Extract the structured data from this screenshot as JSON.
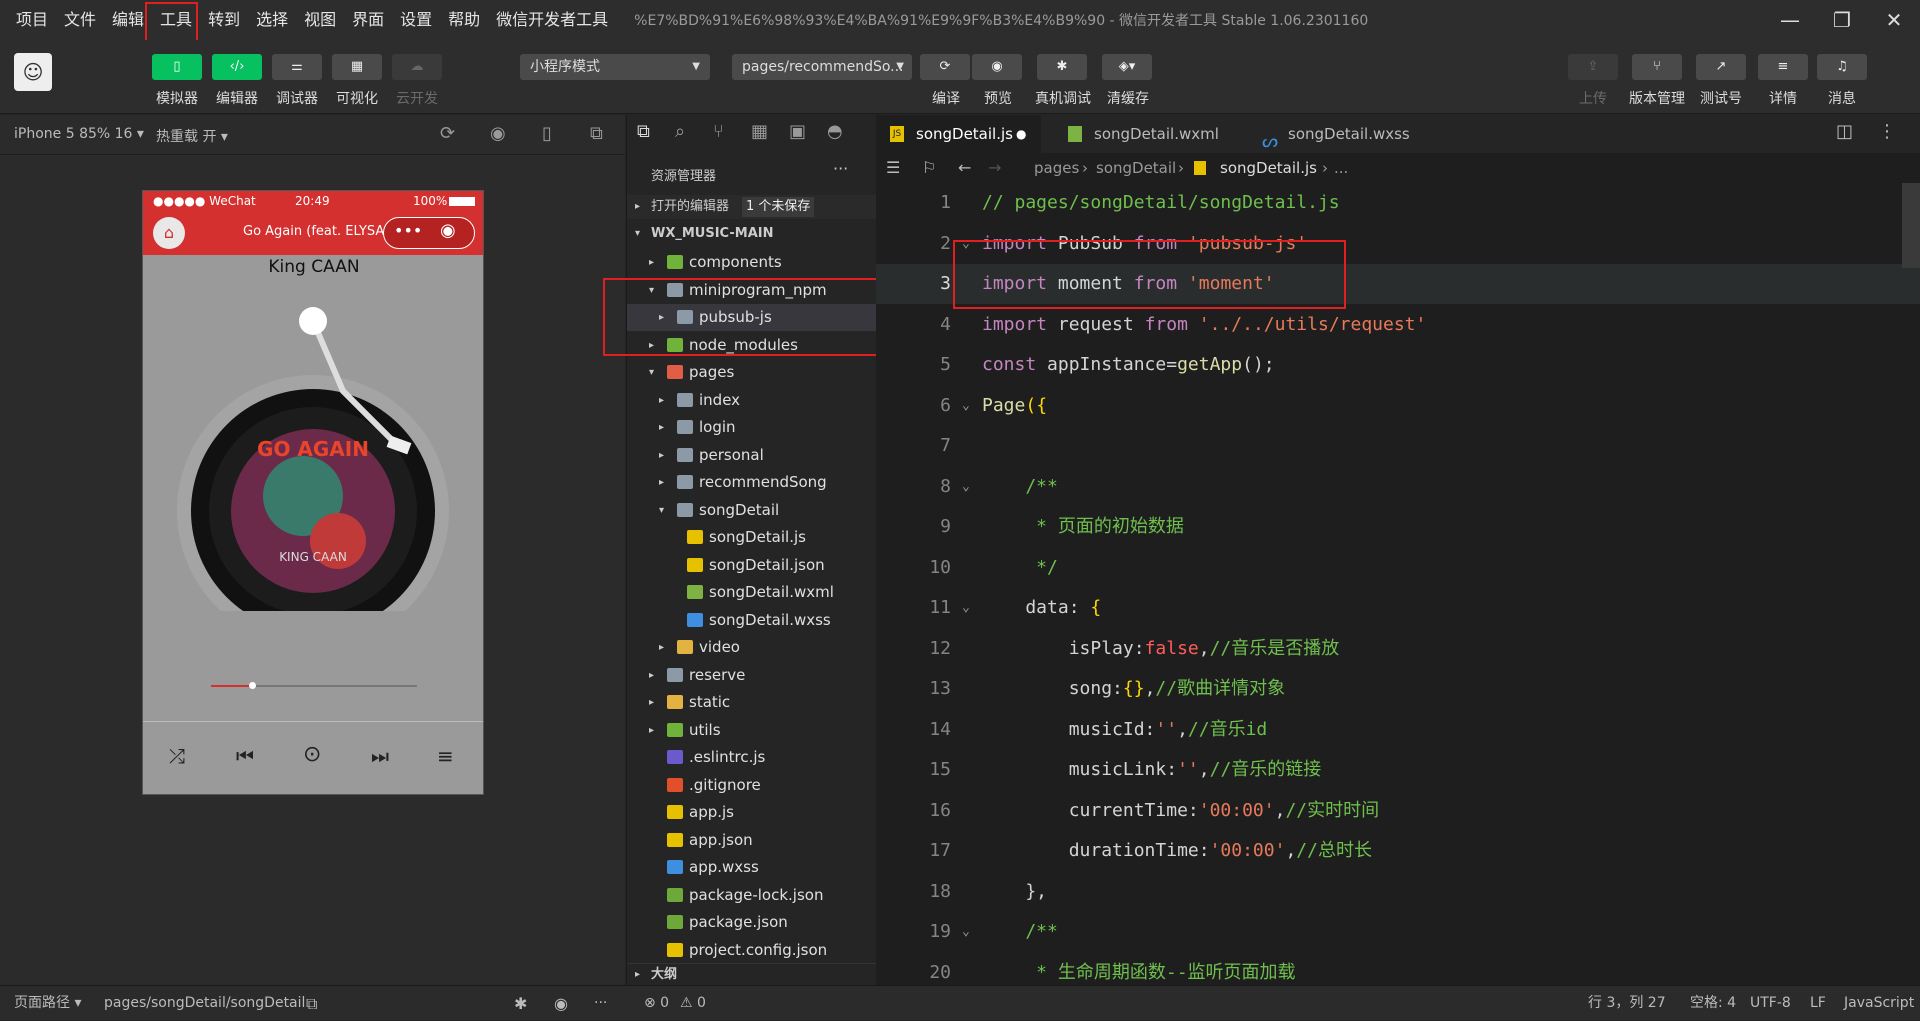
{
  "menubar": {
    "items": [
      "项目",
      "文件",
      "编辑",
      "工具",
      "转到",
      "选择",
      "视图",
      "界面",
      "设置",
      "帮助",
      "微信开发者工具"
    ],
    "window_title": "%E7%BD%91%E6%98%93%E4%BA%91%E9%9F%B3%E4%B9%90 - 微信开发者工具 Stable 1.06.2301160"
  },
  "toolbar": {
    "left_buttons": [
      {
        "label": "模拟器",
        "icon": "phone-icon"
      },
      {
        "label": "编辑器",
        "icon": "code-icon"
      },
      {
        "label": "调试器",
        "icon": "sliders-icon"
      },
      {
        "label": "可视化",
        "icon": "layout-icon"
      },
      {
        "label": "云开发",
        "icon": "cloud-icon"
      }
    ],
    "mode_select": "小程序模式",
    "page_select": "pages/recommendSo...",
    "mid_buttons": [
      {
        "label": "编译",
        "icon": "refresh-icon"
      },
      {
        "label": "预览",
        "icon": "eye-icon"
      },
      {
        "label": "真机调试",
        "icon": "bug-icon"
      },
      {
        "label": "清缓存",
        "icon": "layers-icon"
      }
    ],
    "right_buttons": [
      {
        "label": "上传",
        "icon": "upload-icon"
      },
      {
        "label": "版本管理",
        "icon": "branch-icon"
      },
      {
        "label": "测试号",
        "icon": "external-icon"
      },
      {
        "label": "详情",
        "icon": "menu-icon"
      },
      {
        "label": "消息",
        "icon": "bell-icon"
      }
    ]
  },
  "simulator": {
    "device": "iPhone 5 85% 16",
    "hot_reload": "热重载 开",
    "status_left": "●●●●● WeChat",
    "status_time": "20:49",
    "status_battery": "100%",
    "nav_title": "Go Again (feat. ELYSA)",
    "artist": "King CAAN",
    "album_text": "GO AGAIN",
    "album_sub": "KING CAAN",
    "progress": 0.2
  },
  "explorer": {
    "title": "资源管理器",
    "open_editors": "打开的编辑器",
    "unsaved_badge": "1 个未保存",
    "root": "WX_MUSIC-MAIN",
    "outline": "大纲",
    "rows": [
      {
        "label": "components",
        "depth": 1,
        "kind": "folder-green",
        "arrow": "▸"
      },
      {
        "label": "miniprogram_npm",
        "depth": 1,
        "kind": "folder",
        "arrow": "▾"
      },
      {
        "label": "pubsub-js",
        "depth": 2,
        "kind": "folder",
        "arrow": "▸",
        "selected": true
      },
      {
        "label": "node_modules",
        "depth": 1,
        "kind": "folder-green",
        "arrow": "▸"
      },
      {
        "label": "pages",
        "depth": 1,
        "kind": "folder-red",
        "arrow": "▾"
      },
      {
        "label": "index",
        "depth": 2,
        "kind": "folder",
        "arrow": "▸"
      },
      {
        "label": "login",
        "depth": 2,
        "kind": "folder",
        "arrow": "▸"
      },
      {
        "label": "personal",
        "depth": 2,
        "kind": "folder",
        "arrow": "▸"
      },
      {
        "label": "recommendSong",
        "depth": 2,
        "kind": "folder",
        "arrow": "▸"
      },
      {
        "label": "songDetail",
        "depth": 2,
        "kind": "folder",
        "arrow": "▾"
      },
      {
        "label": "songDetail.js",
        "depth": 3,
        "kind": "js",
        "arrow": ""
      },
      {
        "label": "songDetail.json",
        "depth": 3,
        "kind": "json",
        "arrow": ""
      },
      {
        "label": "songDetail.wxml",
        "depth": 3,
        "kind": "wxml",
        "arrow": ""
      },
      {
        "label": "songDetail.wxss",
        "depth": 3,
        "kind": "wxss",
        "arrow": ""
      },
      {
        "label": "video",
        "depth": 2,
        "kind": "folder-yellow",
        "arrow": "▸"
      },
      {
        "label": "reserve",
        "depth": 1,
        "kind": "folder",
        "arrow": "▸"
      },
      {
        "label": "static",
        "depth": 1,
        "kind": "folder-yellow",
        "arrow": "▸"
      },
      {
        "label": "utils",
        "depth": 1,
        "kind": "folder-green",
        "arrow": "▸"
      },
      {
        "label": ".eslintrc.js",
        "depth": 1,
        "kind": "eslint",
        "arrow": ""
      },
      {
        "label": ".gitignore",
        "depth": 1,
        "kind": "git",
        "arrow": ""
      },
      {
        "label": "app.js",
        "depth": 1,
        "kind": "js",
        "arrow": ""
      },
      {
        "label": "app.json",
        "depth": 1,
        "kind": "json",
        "arrow": ""
      },
      {
        "label": "app.wxss",
        "depth": 1,
        "kind": "wxss",
        "arrow": ""
      },
      {
        "label": "package-lock.json",
        "depth": 1,
        "kind": "node",
        "arrow": ""
      },
      {
        "label": "package.json",
        "depth": 1,
        "kind": "node",
        "arrow": ""
      },
      {
        "label": "project.config.json",
        "depth": 1,
        "kind": "json",
        "arrow": ""
      }
    ]
  },
  "editor": {
    "tabs": [
      {
        "label": "songDetail.js",
        "kind": "js",
        "active": true,
        "dirty": "●"
      },
      {
        "label": "songDetail.wxml",
        "kind": "wxml",
        "active": false,
        "dirty": ""
      },
      {
        "label": "songDetail.wxss",
        "kind": "wxss",
        "active": false,
        "dirty": ""
      }
    ],
    "breadcrumb": [
      "pages",
      "songDetail",
      "songDetail.js",
      "..."
    ],
    "lines": [
      [
        {
          "t": "// pages/songDetail/songDetail.js",
          "c": "cm"
        }
      ],
      [
        {
          "t": "import",
          "c": "kw"
        },
        {
          "t": " PubSub ",
          "c": "id"
        },
        {
          "t": "from",
          "c": "kw"
        },
        {
          "t": " 'pubsub-js'",
          "c": "str"
        }
      ],
      [
        {
          "t": "import",
          "c": "kw"
        },
        {
          "t": " moment ",
          "c": "id"
        },
        {
          "t": "from",
          "c": "kw"
        },
        {
          "t": " 'moment'",
          "c": "str"
        }
      ],
      [
        {
          "t": "import",
          "c": "kw"
        },
        {
          "t": " request ",
          "c": "id"
        },
        {
          "t": "from",
          "c": "kw"
        },
        {
          "t": " '../../utils/request'",
          "c": "str"
        }
      ],
      [
        {
          "t": "const",
          "c": "kw"
        },
        {
          "t": " appInstance=",
          "c": "id"
        },
        {
          "t": "getApp",
          "c": "fn"
        },
        {
          "t": "();",
          "c": "id"
        }
      ],
      [
        {
          "t": "Page",
          "c": "fn"
        },
        {
          "t": "({",
          "c": "br"
        }
      ],
      [
        {
          "t": "",
          "c": "id"
        }
      ],
      [
        {
          "t": "    /**",
          "c": "cm"
        }
      ],
      [
        {
          "t": "     * 页面的初始数据",
          "c": "cm"
        }
      ],
      [
        {
          "t": "     */",
          "c": "cm"
        }
      ],
      [
        {
          "t": "    data: ",
          "c": "id"
        },
        {
          "t": "{",
          "c": "br"
        }
      ],
      [
        {
          "t": "        isPlay:",
          "c": "id"
        },
        {
          "t": "false",
          "c": "bool"
        },
        {
          "t": ",",
          "c": "id"
        },
        {
          "t": "//音乐是否播放",
          "c": "cm"
        }
      ],
      [
        {
          "t": "        song:",
          "c": "id"
        },
        {
          "t": "{}",
          "c": "br"
        },
        {
          "t": ",",
          "c": "id"
        },
        {
          "t": "//歌曲详情对象",
          "c": "cm"
        }
      ],
      [
        {
          "t": "        musicId:",
          "c": "id"
        },
        {
          "t": "''",
          "c": "str"
        },
        {
          "t": ",",
          "c": "id"
        },
        {
          "t": "//音乐id",
          "c": "cm"
        }
      ],
      [
        {
          "t": "        musicLink:",
          "c": "id"
        },
        {
          "t": "''",
          "c": "str"
        },
        {
          "t": ",",
          "c": "id"
        },
        {
          "t": "//音乐的链接",
          "c": "cm"
        }
      ],
      [
        {
          "t": "        currentTime:",
          "c": "id"
        },
        {
          "t": "'00:00'",
          "c": "str"
        },
        {
          "t": ",",
          "c": "id"
        },
        {
          "t": "//实时时间",
          "c": "cm"
        }
      ],
      [
        {
          "t": "        durationTime:",
          "c": "id"
        },
        {
          "t": "'00:00'",
          "c": "str"
        },
        {
          "t": ",",
          "c": "id"
        },
        {
          "t": "//总时长",
          "c": "cm"
        }
      ],
      [
        {
          "t": "    },",
          "c": "id"
        }
      ],
      [
        {
          "t": "    /**",
          "c": "cm"
        }
      ],
      [
        {
          "t": "     * 生命周期函数--监听页面加载",
          "c": "cm"
        }
      ]
    ]
  },
  "statusbar": {
    "page_path_label": "页面路径",
    "page_path": "pages/songDetail/songDetail",
    "errors": "⊗ 0",
    "warnings": "⚠ 0",
    "cursor": "行 3，列 27",
    "indent": "空格: 4",
    "encoding": "UTF-8",
    "eol": "LF",
    "language": "JavaScript"
  },
  "colors": {
    "accent_green": "#07c160",
    "nav_red": "#d3302f",
    "highlight_red": "#e02020"
  }
}
